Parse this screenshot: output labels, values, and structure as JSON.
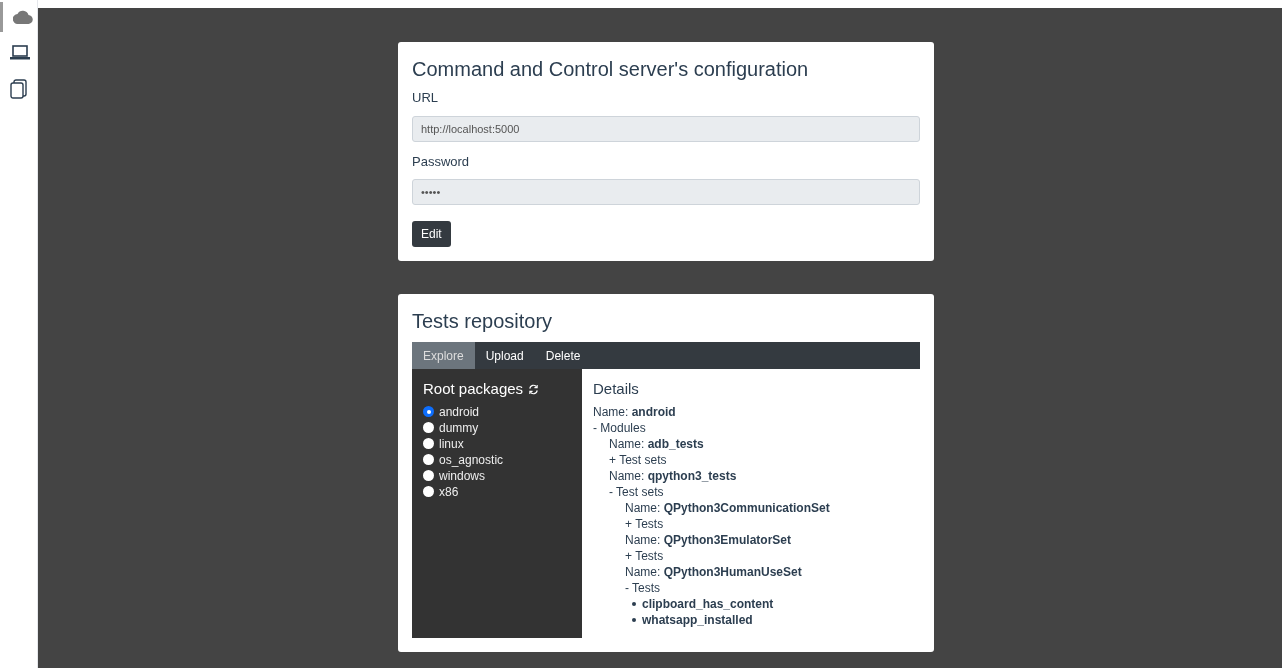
{
  "sidebar": {
    "items": [
      {
        "kind": "cloud",
        "selected": true
      },
      {
        "kind": "laptop",
        "selected": false
      },
      {
        "kind": "copy",
        "selected": false
      }
    ]
  },
  "config_card": {
    "title": "Command and Control server's configuration",
    "fields": [
      {
        "label": "URL",
        "value": "http://localhost:5000"
      },
      {
        "label": "Password",
        "value": "•••••"
      }
    ],
    "button": "Edit"
  },
  "tests_card": {
    "title": "Tests repository",
    "tabs": [
      {
        "label": "Explore",
        "selected": true
      },
      {
        "label": "Upload",
        "selected": false
      },
      {
        "label": "Delete",
        "selected": false
      }
    ],
    "packages": {
      "title": "Root packages",
      "items": [
        {
          "label": "android",
          "selected": true
        },
        {
          "label": "dummy",
          "selected": false
        },
        {
          "label": "linux",
          "selected": false
        },
        {
          "label": "os_agnostic",
          "selected": false
        },
        {
          "label": "windows",
          "selected": false
        },
        {
          "label": "x86",
          "selected": false
        }
      ]
    },
    "details": {
      "title": "Details",
      "tree": [
        {
          "line": "Name: **android**",
          "toggle": "- Modules",
          "children": [
            {
              "line": "Name: **adb_tests**",
              "toggle": "+ Test sets"
            },
            {
              "line": "Name: **qpython3_tests**",
              "toggle": "- Test sets",
              "children": [
                {
                  "line": "Name: **QPython3CommunicationSet**",
                  "toggle": "+ Tests"
                },
                {
                  "line": "Name: **QPython3EmulatorSet**",
                  "toggle": "+ Tests"
                },
                {
                  "line": "Name: **QPython3HumanUseSet**",
                  "toggle": "- Tests",
                  "tests": [
                    "clipboard_has_content",
                    "whatsapp_installed"
                  ]
                }
              ]
            }
          ]
        }
      ]
    }
  }
}
